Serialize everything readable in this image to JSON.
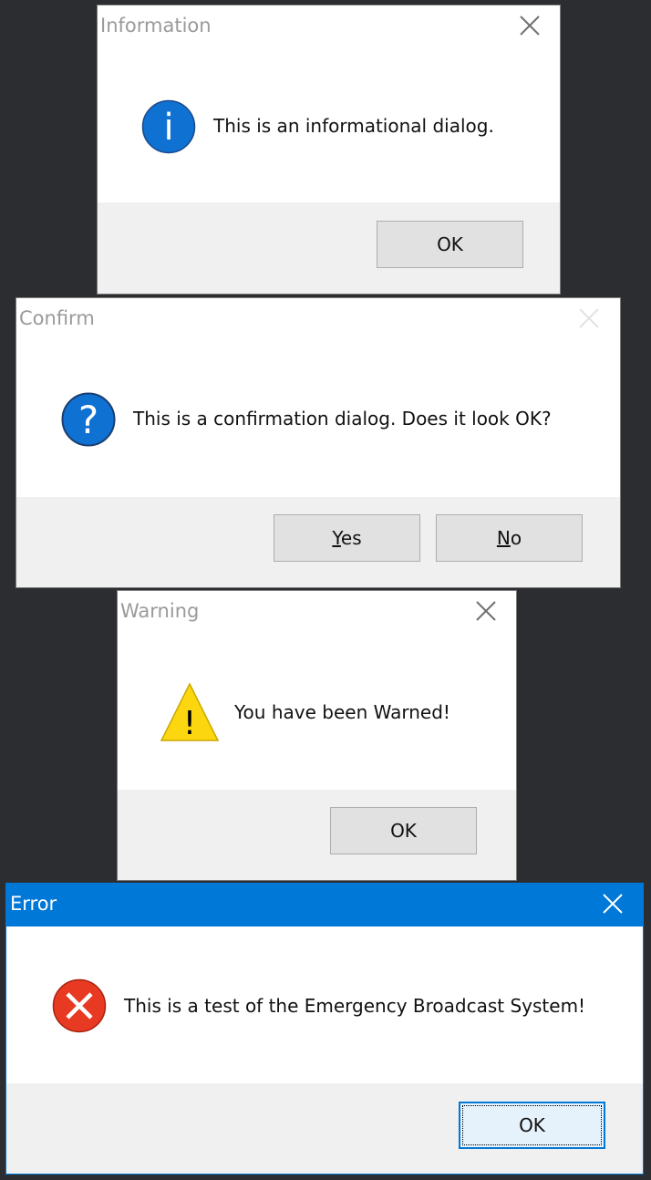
{
  "dialogs": {
    "information": {
      "title": "Information",
      "message": "This is an informational dialog.",
      "ok": "OK"
    },
    "confirm": {
      "title": "Confirm",
      "message": "This is a confirmation dialog. Does it look OK?",
      "yes_mnemonic": "Y",
      "yes_rest": "es",
      "no_mnemonic": "N",
      "no_rest": "o"
    },
    "warning": {
      "title": "Warning",
      "message": "You have been Warned!",
      "ok": "OK"
    },
    "error": {
      "title": "Error",
      "message": "This is a test of the Emergency Broadcast System!",
      "ok": "OK"
    }
  },
  "icons": {
    "info": "i",
    "question": "?",
    "warning": "!"
  },
  "colors": {
    "background": "#2b2d31",
    "info_blue": "#0f71d2",
    "error_red": "#e83a23",
    "warning_yellow": "#fcd70f",
    "active_titlebar": "#0078d7"
  }
}
